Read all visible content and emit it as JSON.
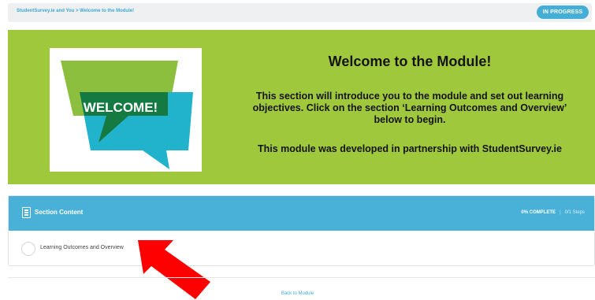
{
  "breadcrumb": "StudentSurvey.ie and You > Welcome to the Module!",
  "status_badge": "IN PROGRESS",
  "hero": {
    "image_text": "WELCOME!",
    "title": "Welcome to the Module!",
    "intro_line1": "This section will introduce you to the module and set out learning",
    "intro_line2": "objectives.  Click on the section ‘Learning Outcomes and Overview’",
    "intro_line3": "below to begin.",
    "credit": "This module was developed in partnership with StudentSurvey.ie"
  },
  "section": {
    "icon": "document-icon",
    "title": "Section Content",
    "progress_percent": "0% COMPLETE",
    "separator": "|",
    "progress_steps": "0/1 Steps",
    "lessons": [
      {
        "label": "Learning Outcomes and Overview",
        "complete": false
      }
    ]
  },
  "back_link": "Back to Module",
  "colors": {
    "accent": "#45aed6",
    "hero_bg": "#a0c83c",
    "bubble_blue": "#21b3cc",
    "bubble_green": "#8dbf3e",
    "bubble_dark": "#157a42",
    "annotation_arrow": "#ff0000"
  }
}
